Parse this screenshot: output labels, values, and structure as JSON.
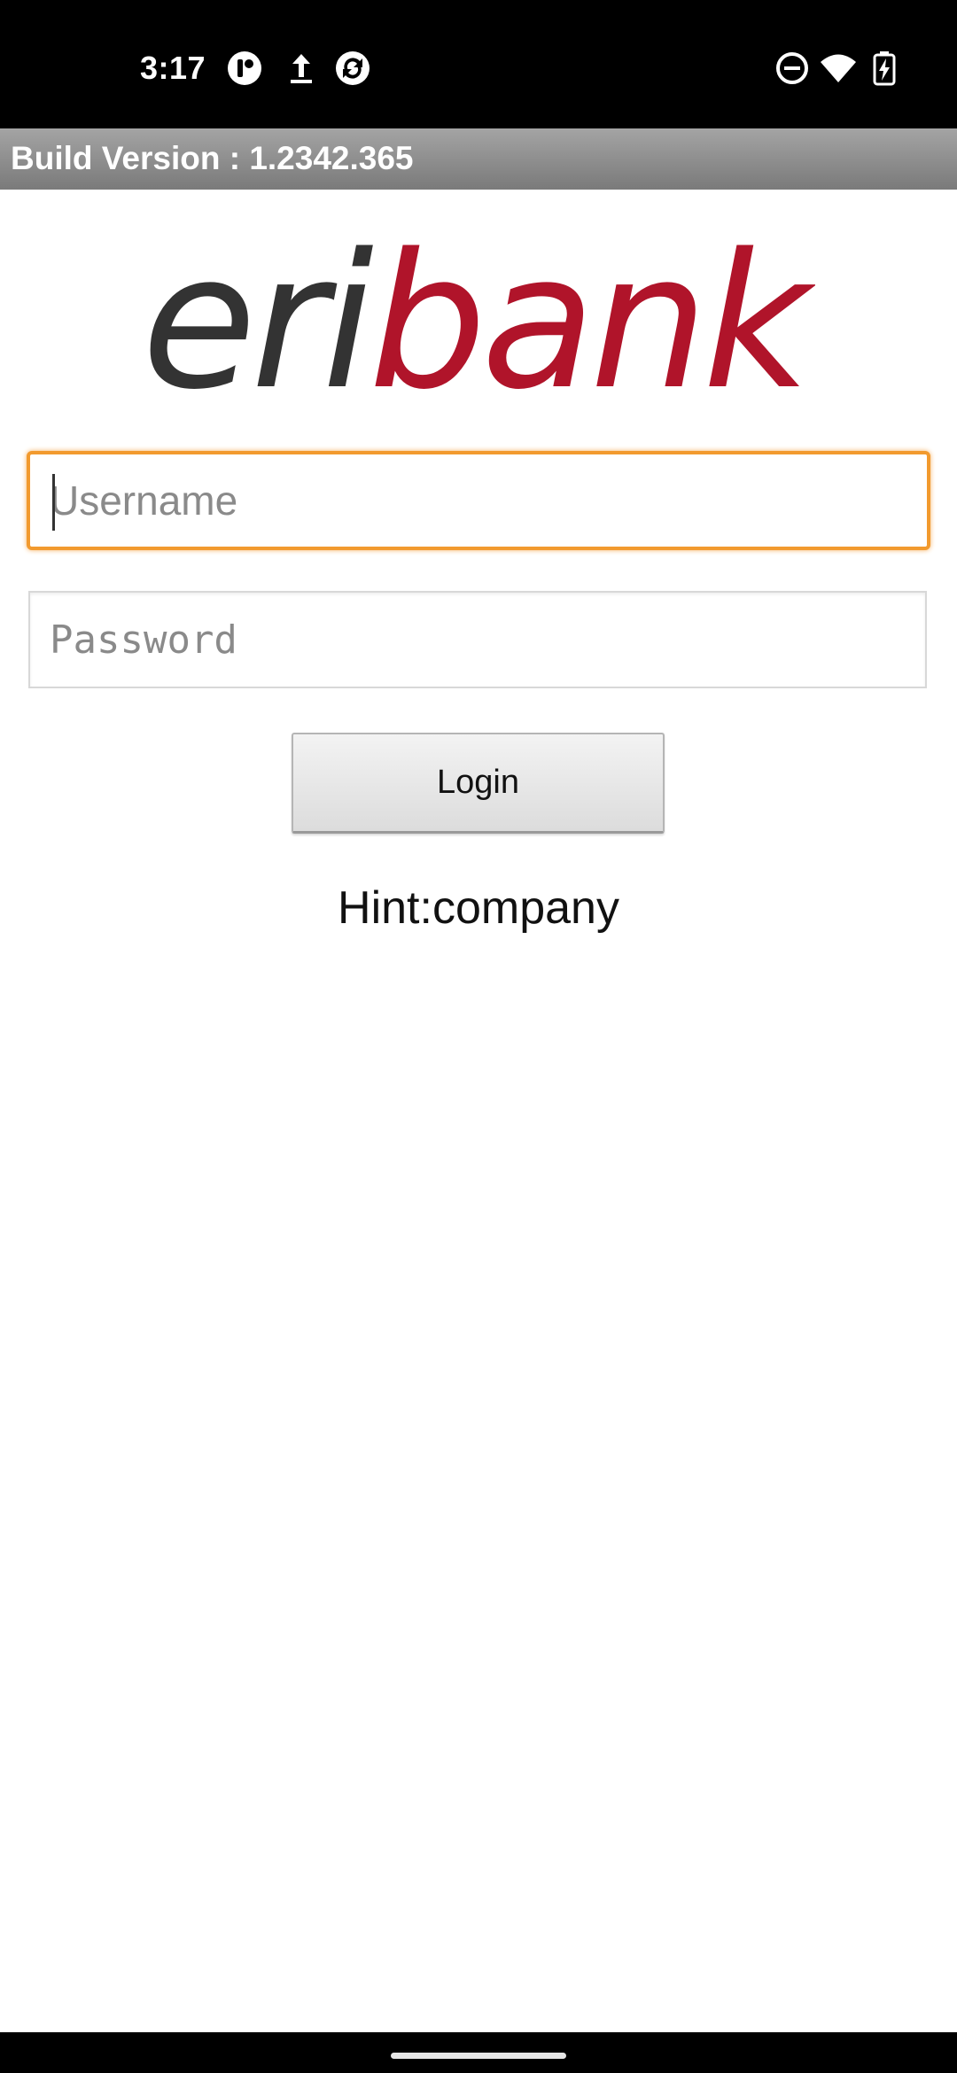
{
  "status_bar": {
    "time": "3:17",
    "left_icons": [
      "app-notification-icon",
      "upload-icon",
      "app-sync-icon"
    ],
    "right_icons": [
      "do-not-disturb-icon",
      "wifi-icon",
      "battery-charging-icon"
    ]
  },
  "app": {
    "build_version": "Build Version : 1.2342.365",
    "logo": {
      "text_dark": "eri",
      "text_red": "bank",
      "color_dark": "#333333",
      "color_red": "#b0142a"
    }
  },
  "login_form": {
    "username_placeholder": "Username",
    "username_value": "",
    "password_placeholder": "Password",
    "password_value": "",
    "login_label": "Login",
    "hint": "Hint:company"
  },
  "colors": {
    "focus_border": "#f29a2e",
    "status_bar": "#000000",
    "build_bar": "#8c8c8c"
  }
}
